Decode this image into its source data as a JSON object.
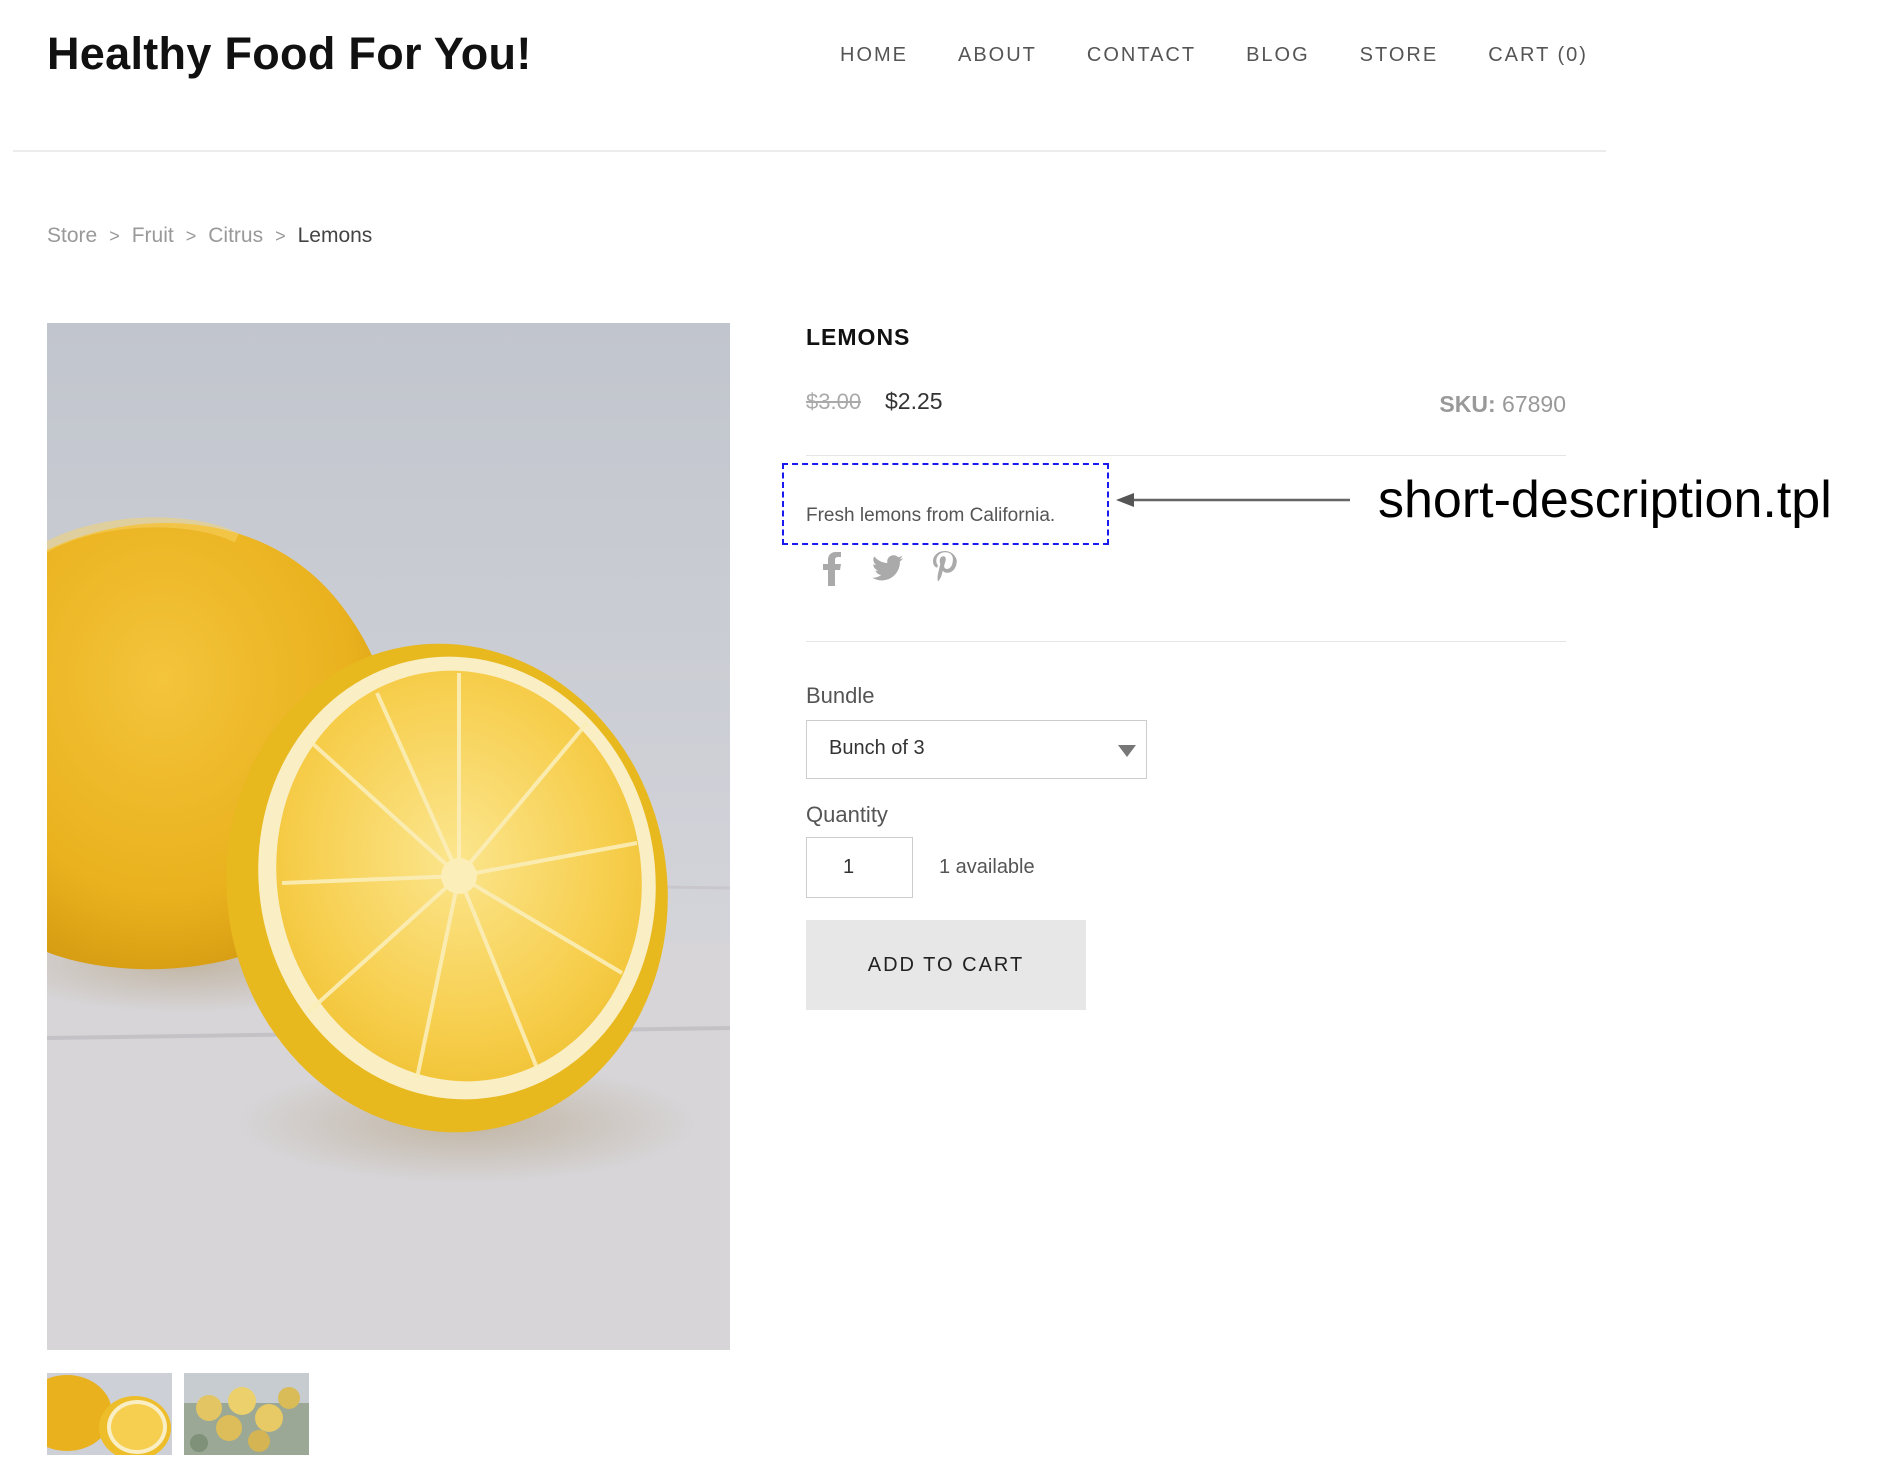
{
  "header": {
    "site_title": "Healthy Food For You!",
    "nav": [
      "HOME",
      "ABOUT",
      "CONTACT",
      "BLOG",
      "STORE",
      "CART (0)"
    ]
  },
  "breadcrumb": [
    "Store",
    "Fruit",
    "Citrus",
    "Lemons"
  ],
  "breadcrumb_separator": ">",
  "product": {
    "name": "LEMONS",
    "price_old": "$3.00",
    "price_new": "$2.25",
    "sku_label": "SKU:",
    "sku_value": "67890",
    "short_description": "Fresh lemons from California.",
    "social_icons": [
      "facebook-icon",
      "twitter-icon",
      "pinterest-icon"
    ],
    "bundle_label": "Bundle",
    "bundle_selected": "Bunch of 3",
    "quantity_label": "Quantity",
    "quantity_value": "1",
    "availability": "1 available",
    "add_to_cart_label": "ADD TO CART"
  },
  "annotation": {
    "label": "short-description.tpl",
    "box_color": "#1a1aee"
  },
  "images": {
    "main": "lemon-photo",
    "thumbnails": [
      "lemon-photo-thumb",
      "lemon-tree-thumb"
    ]
  }
}
